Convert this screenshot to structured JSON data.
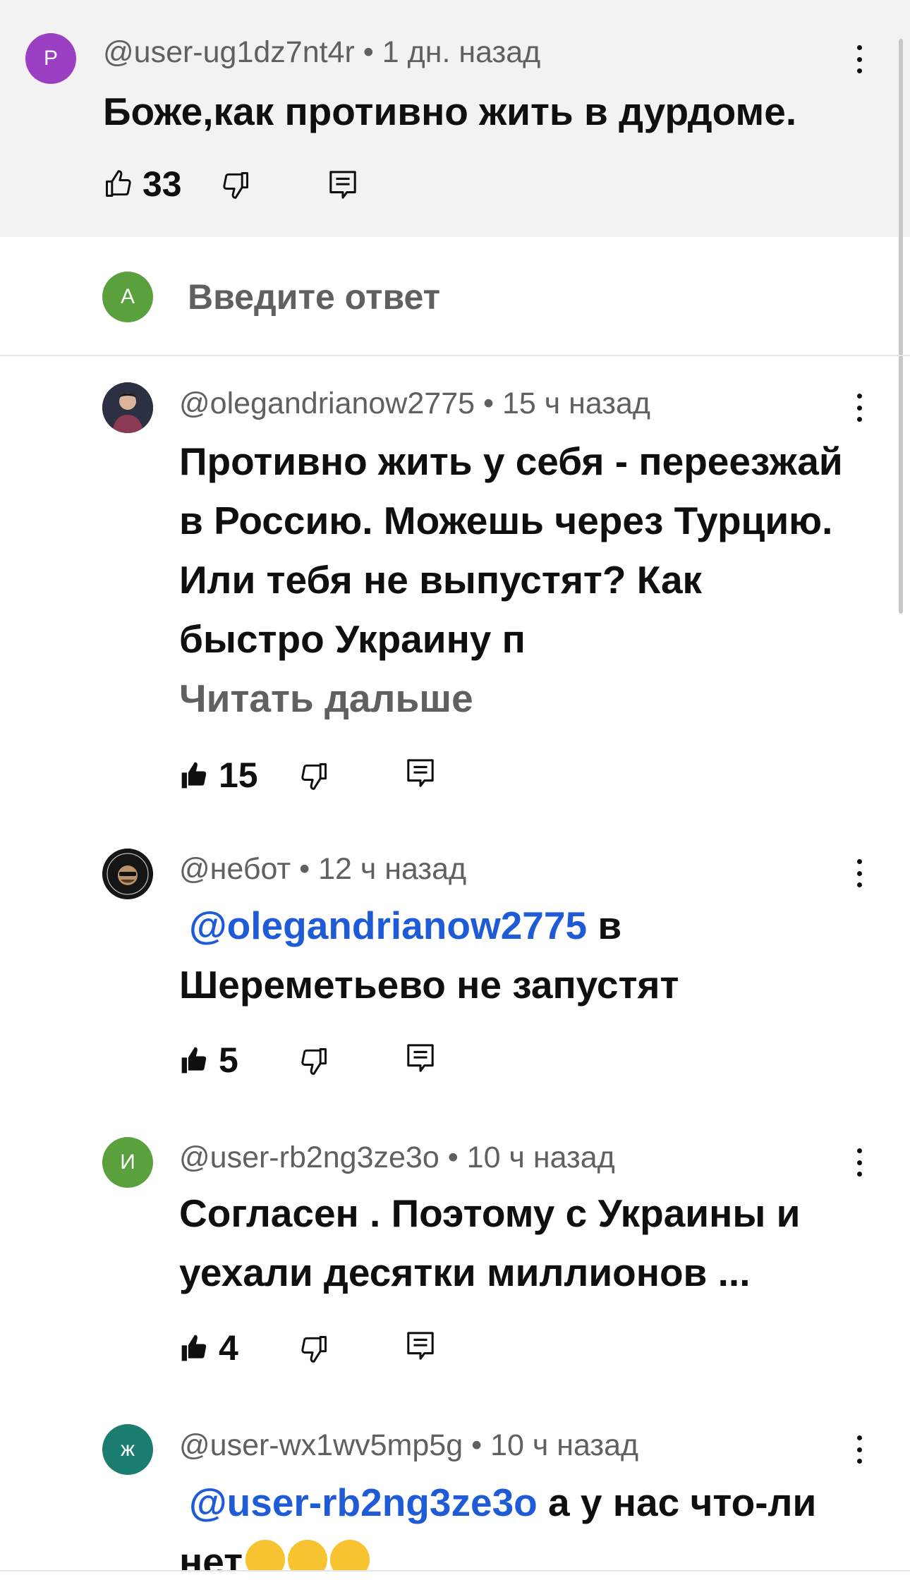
{
  "main_comment": {
    "avatar_letter": "P",
    "avatar_color": "#9b3fc2",
    "author": "@user-ug1dz7nt4r",
    "time": "1 дн. назад",
    "text": "Боже,как противно жить в дурдоме.",
    "likes": "33"
  },
  "reply_input": {
    "avatar_letter": "A",
    "avatar_color": "#5aa03d",
    "placeholder": "Введите ответ"
  },
  "replies": [
    {
      "author": "@olegandrianow2775",
      "time": "15 ч назад",
      "text": "Противно жить у себя - переезжай в Россию. Можешь через Турцию. Или тебя не выпустят? Как быстро Украину п",
      "read_more": "Читать дальше",
      "likes": "15"
    },
    {
      "author": "@небот",
      "time": "12 ч назад",
      "mention": "@olegandrianow2775",
      "text": " в Шереметьево не запустят",
      "likes": "5"
    },
    {
      "avatar_letter": "И",
      "avatar_color": "#5aa03d",
      "author": "@user-rb2ng3ze3o",
      "time": "10 ч назад",
      "text": "Согласен . Поэтому с Украины и уехали десятки миллионов ...",
      "likes": "4"
    },
    {
      "avatar_letter": "ж",
      "avatar_color": "#1b7d6f",
      "author": "@user-wx1wv5mp5g",
      "time": "10 ч назад",
      "mention": "@user-rb2ng3ze3o",
      "text": "  а у нас что-ли нет",
      "emoji": "crying-laughing-face-icon"
    }
  ],
  "icons": [
    "like-outline-icon",
    "like-filled-icon",
    "dislike-icon",
    "reply-icon",
    "more-vert-icon"
  ]
}
